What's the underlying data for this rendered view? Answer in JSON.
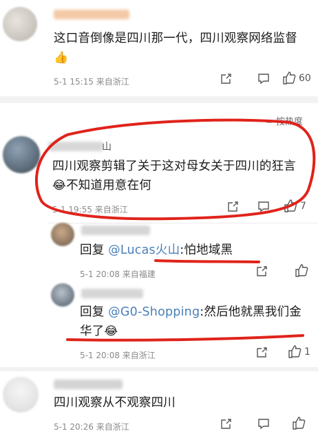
{
  "comments": [
    {
      "text": "这口音倒像是四川那一代，四川观察网络监督",
      "emoji": "👍",
      "meta": "5-1 15:15 来自浙江",
      "likes": "60"
    },
    {
      "name_hint": "山",
      "text_line1": "四川观察剪辑了关于这对母女关于四川的狂言",
      "text_line2": "不知道用意在何",
      "emoji": "😂",
      "meta": "5-1 19:55 来自浙江",
      "likes": "7"
    },
    {
      "reply_prefix": "回复 ",
      "mention": "@Lucas火山",
      "text": ":怕地域黑",
      "meta": "5-1 20:08 来自福建"
    },
    {
      "reply_prefix": "回复 ",
      "mention": "@G0-Shopping",
      "text_line1": ":然后他就黑我们金",
      "text_line2": "华了",
      "emoji": "😂",
      "meta": "5-1 20:08 来自浙江",
      "likes": "1"
    },
    {
      "text": "四川观察从不观察四川",
      "meta": "5-1 20:26 来自浙江"
    }
  ],
  "sort": {
    "label": "按热度",
    "prefix": "="
  },
  "colors": {
    "annotation": "#e0231b",
    "mention": "#4a7fb8"
  }
}
